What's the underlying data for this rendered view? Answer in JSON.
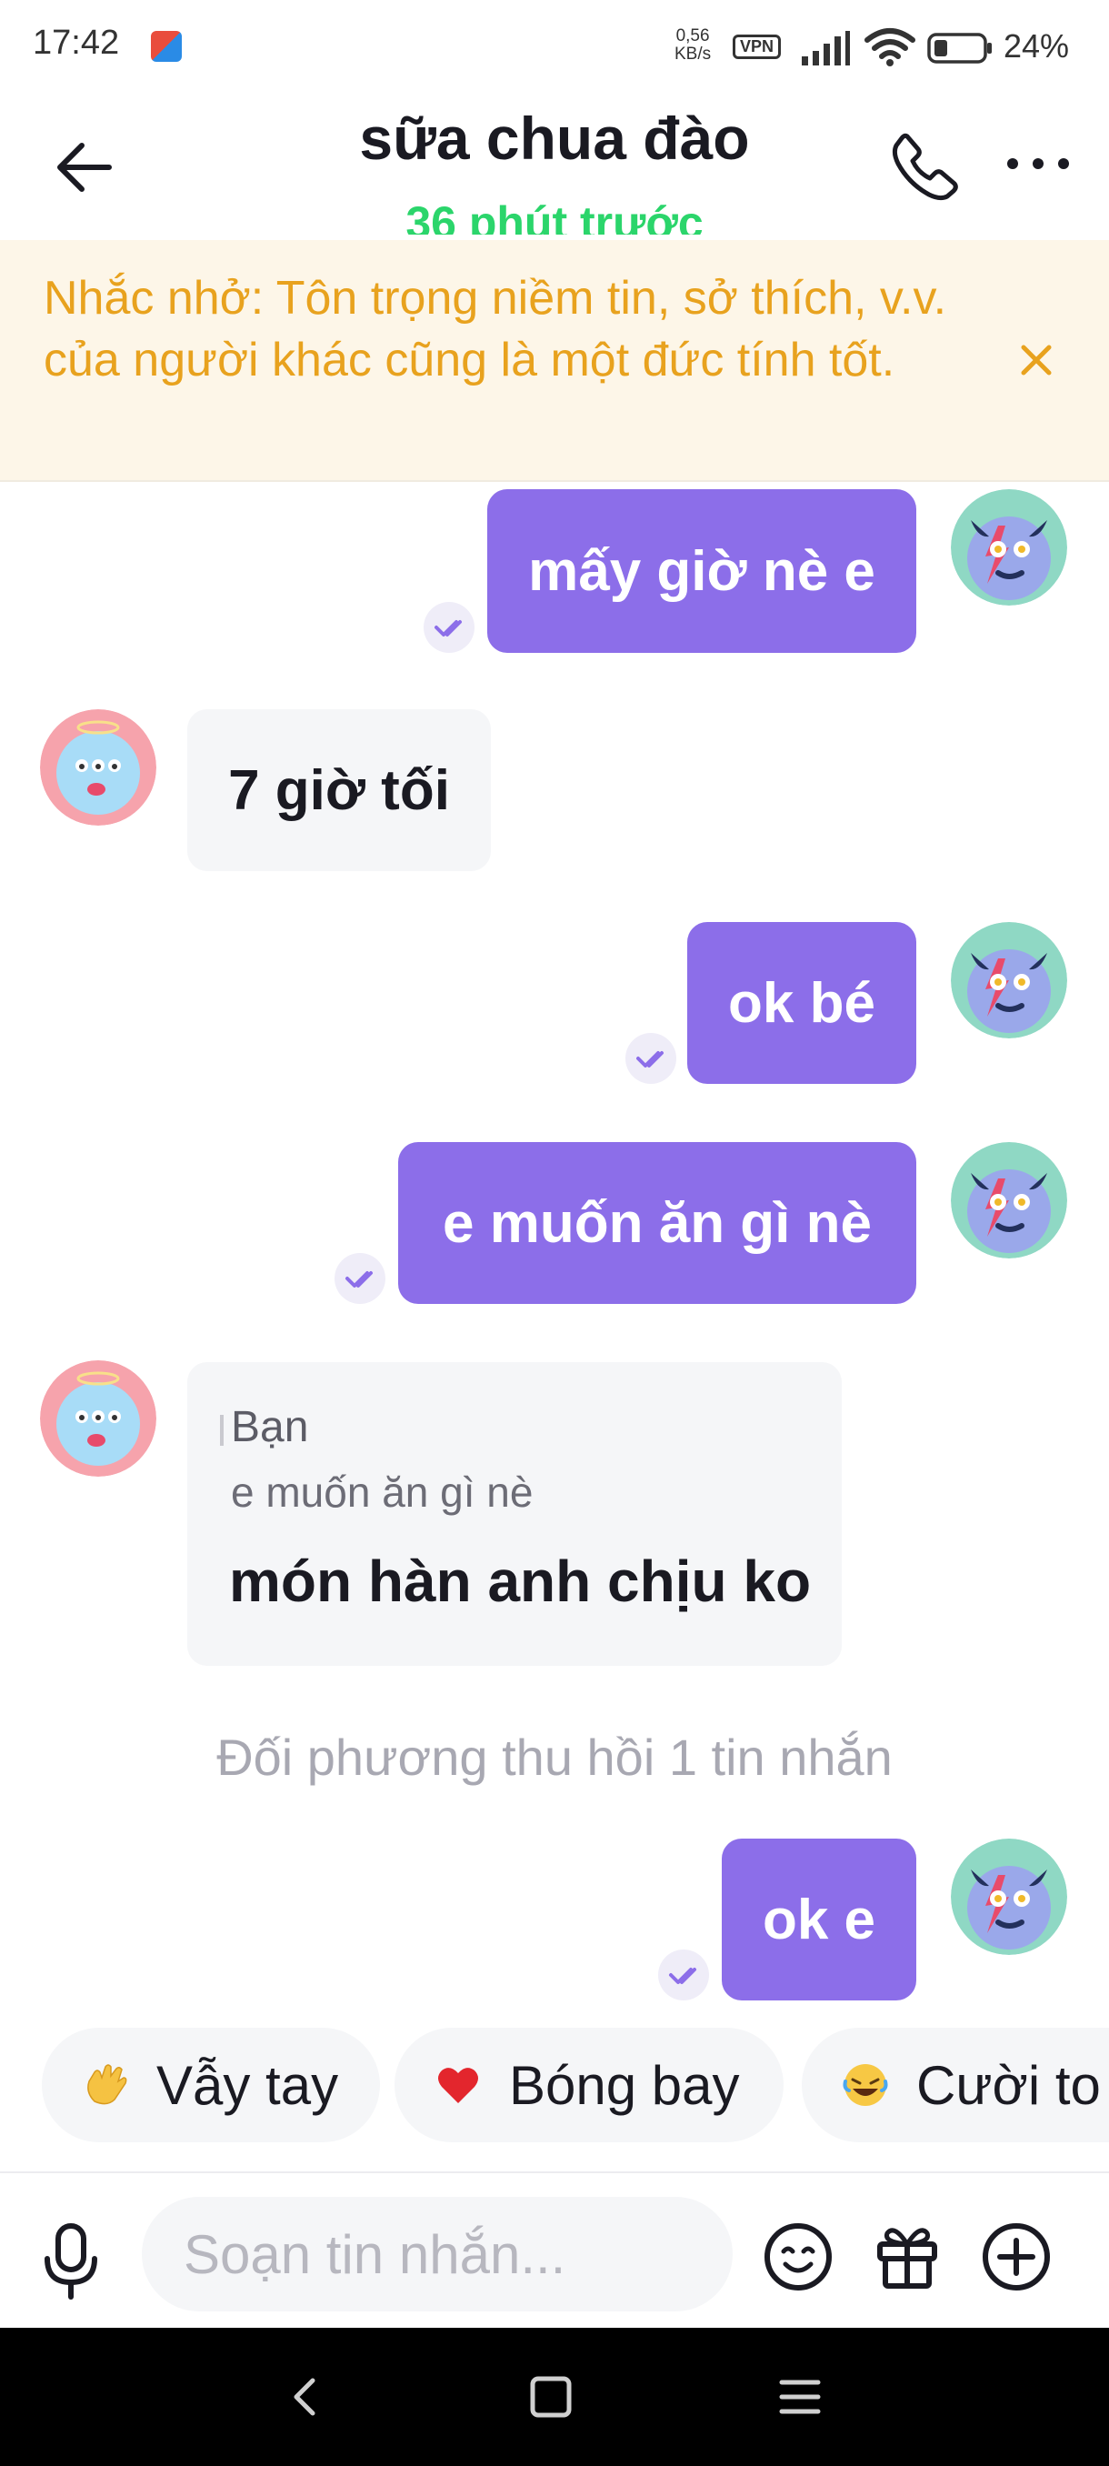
{
  "status_bar": {
    "time": "17:42",
    "net_speed_value": "0,56",
    "net_speed_unit": "KB/s",
    "vpn": "VPN",
    "battery": "24%"
  },
  "header": {
    "title": "sữa chua đào",
    "subtitle": "36 phút trước"
  },
  "notice": {
    "text": "Nhắc nhở: Tôn trọng niềm tin, sở thích, v.v. của người khác cũng là một đức tính tốt."
  },
  "messages": [
    {
      "from": "me",
      "text": "mấy giờ nè e"
    },
    {
      "from": "other",
      "text": "7 giờ tối"
    },
    {
      "from": "me",
      "text": "ok bé"
    },
    {
      "from": "me",
      "text": "e muốn ăn gì nè"
    },
    {
      "from": "other",
      "quote_name": "Bạn",
      "quote_text": "e muốn ăn gì nè",
      "text": "món hàn anh chịu ko"
    },
    {
      "from": "me",
      "text": "ok e"
    }
  ],
  "system_notice": "Đối phương thu hồi 1 tin nhắn",
  "quick_replies": [
    {
      "icon": "waving-hand-icon",
      "label": "Vẫy tay"
    },
    {
      "icon": "red-heart-icon",
      "label": "Bóng bay"
    },
    {
      "icon": "laughing-face-icon",
      "label": "Cười to"
    }
  ],
  "composer": {
    "placeholder": "Soạn tin nhắn..."
  },
  "colors": {
    "accent": "#8c6ee9",
    "online": "#2bd56b",
    "notice_text": "#e8a21e",
    "notice_bg": "#fdf6e8",
    "incoming_bubble": "#f5f6f8"
  }
}
